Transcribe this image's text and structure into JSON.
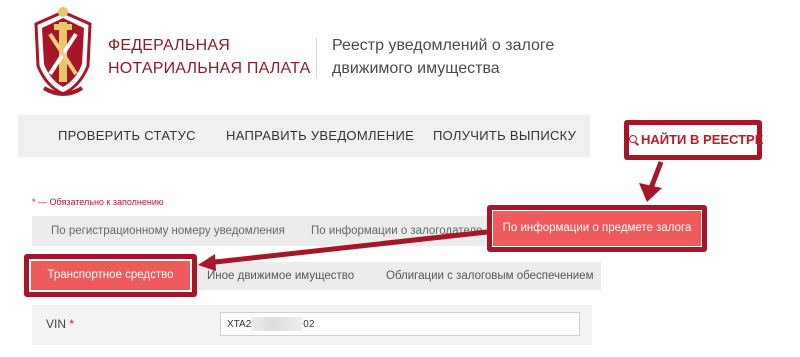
{
  "header": {
    "org_line1": "ФЕДЕРАЛЬНАЯ",
    "org_line2": "НОТАРИАЛЬНАЯ ПАЛАТА",
    "registry_line1": "Реестр уведомлений о залоге",
    "registry_line2": "движимого имущества",
    "logo_icon": "notary-emblem-icon"
  },
  "nav": {
    "items": [
      {
        "label": "ПРОВЕРИТЬ СТАТУС"
      },
      {
        "label": "НАПРАВИТЬ УВЕДОМЛЕНИЕ"
      },
      {
        "label": "ПОЛУЧИТЬ ВЫПИСКУ"
      }
    ],
    "search_label": "НАЙТИ В РЕЕСТРЕ",
    "search_icon": "search-icon"
  },
  "form": {
    "required_star": "*",
    "required_note": " — Обязательно к заполнению",
    "criteria_tabs": [
      {
        "label": "По регистрационному номеру уведомления"
      },
      {
        "label": "По информации о залогодателе"
      },
      {
        "label": "По информации о предмете залога"
      }
    ],
    "subject_tabs": [
      {
        "label": "Транспортное средство"
      },
      {
        "label": "Иное движимое имущество"
      },
      {
        "label": "Облигации с залоговым обеспечением"
      }
    ],
    "vin_label": "VIN",
    "vin_star": "*",
    "vin_value_start": "XTA2",
    "vin_value_end": "02"
  },
  "colors": {
    "brand": "#8b1c2c",
    "accent": "#ef5a5a",
    "highlight": "#a71628"
  }
}
